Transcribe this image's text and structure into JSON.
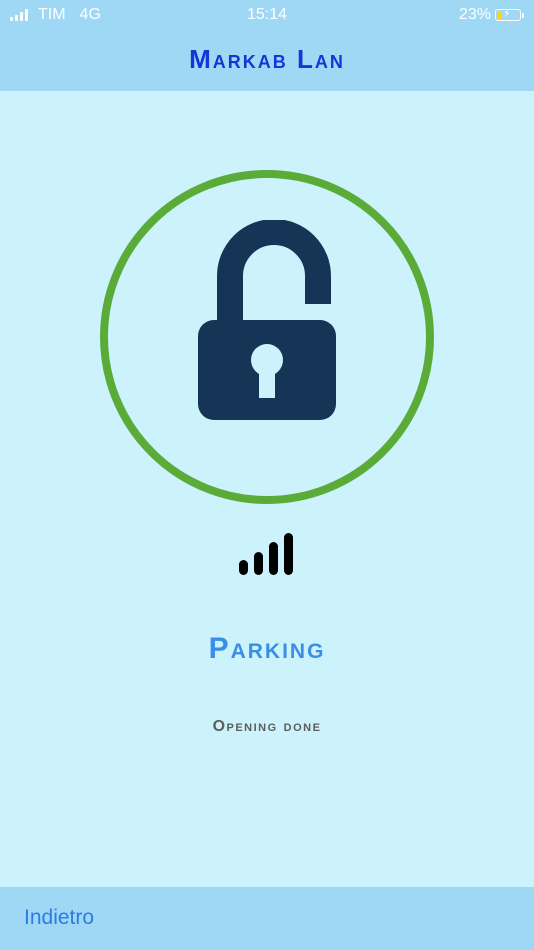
{
  "status_bar": {
    "carrier": "TIM",
    "network": "4G",
    "time": "15:14",
    "battery": "23%",
    "battery_level_percent": 23,
    "signal_icon": "cellular-signal-icon",
    "battery_icon": "battery-charging-icon"
  },
  "header": {
    "title": "Markab Lan"
  },
  "lock": {
    "state_icon": "unlocked-padlock-icon",
    "ring_color": "#5aab38",
    "lock_color": "#163556"
  },
  "signal_indicator": {
    "icon": "signal-strength-icon",
    "bars": 4
  },
  "device": {
    "name": "Parking",
    "status_message": "Opening done"
  },
  "footer": {
    "back_label": "Indietro"
  },
  "colors": {
    "bar_background": "#9fd8f5",
    "page_background": "#ccf3fb",
    "title_color": "#1237d6",
    "device_name_color": "#3b8ee8",
    "back_link_color": "#2a7de3"
  }
}
